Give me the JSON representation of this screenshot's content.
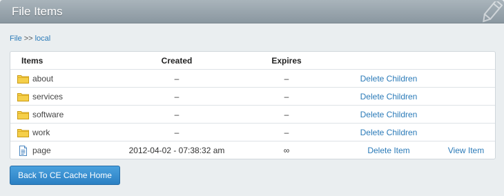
{
  "header": {
    "title": "File Items",
    "icon": "pencil-icon"
  },
  "breadcrumb": {
    "root": "File",
    "separator": ">>",
    "current": "local"
  },
  "table": {
    "columns": {
      "items": "Items",
      "created": "Created",
      "expires": "Expires"
    },
    "rows": [
      {
        "type": "folder",
        "icon": "folder-icon",
        "name": "about",
        "created": "–",
        "expires": "–",
        "action": "Delete Children",
        "view": ""
      },
      {
        "type": "folder",
        "icon": "folder-icon",
        "name": "services",
        "created": "–",
        "expires": "–",
        "action": "Delete Children",
        "view": ""
      },
      {
        "type": "folder",
        "icon": "folder-icon",
        "name": "software",
        "created": "–",
        "expires": "–",
        "action": "Delete Children",
        "view": ""
      },
      {
        "type": "folder",
        "icon": "folder-icon",
        "name": "work",
        "created": "–",
        "expires": "–",
        "action": "Delete Children",
        "view": ""
      },
      {
        "type": "file",
        "icon": "document-icon",
        "name": "page",
        "created": "2012-04-02 - 07:38:32 am",
        "expires": "∞",
        "action": "Delete Item",
        "view": "View Item"
      }
    ]
  },
  "footer": {
    "back_button": "Back To CE Cache Home"
  },
  "colors": {
    "link": "#2a7ab8",
    "button": "#2b80c3",
    "titlebar": "#8a97a0"
  }
}
